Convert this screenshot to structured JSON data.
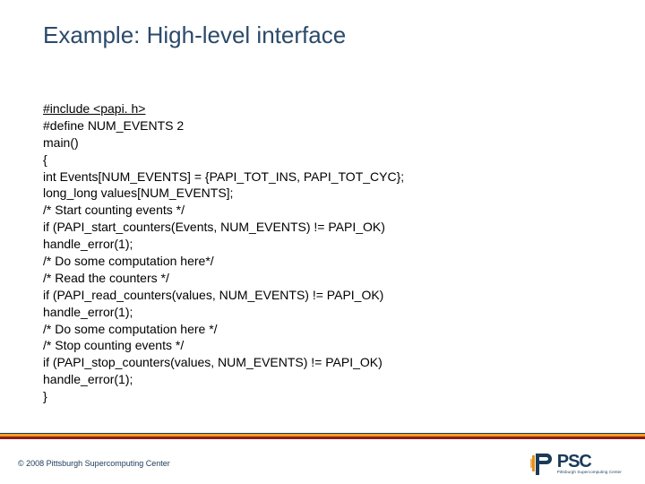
{
  "title": "Example: High-level interface",
  "code": [
    {
      "text": "#include <papi. h>",
      "underline": true
    },
    {
      "text": "#define NUM_EVENTS 2"
    },
    {
      "text": "main()"
    },
    {
      "text": "{"
    },
    {
      "text": "int Events[NUM_EVENTS] = {PAPI_TOT_INS, PAPI_TOT_CYC};"
    },
    {
      "text": "long_long values[NUM_EVENTS];"
    },
    {
      "text": "/* Start counting events */"
    },
    {
      "text": "if (PAPI_start_counters(Events, NUM_EVENTS) != PAPI_OK)"
    },
    {
      "text": "handle_error(1);"
    },
    {
      "text": "/* Do some computation here*/"
    },
    {
      "text": "/* Read the counters */"
    },
    {
      "text": "if (PAPI_read_counters(values, NUM_EVENTS) != PAPI_OK)"
    },
    {
      "text": "handle_error(1);"
    },
    {
      "text": "/* Do some computation here */"
    },
    {
      "text": "/* Stop counting events */"
    },
    {
      "text": "if (PAPI_stop_counters(values, NUM_EVENTS) != PAPI_OK)"
    },
    {
      "text": "handle_error(1);"
    },
    {
      "text": "}"
    }
  ],
  "footer": "© 2008 Pittsburgh Supercomputing Center",
  "logo": {
    "psc": "PSC",
    "sub": "Pittsburgh Supercomputing Center"
  }
}
